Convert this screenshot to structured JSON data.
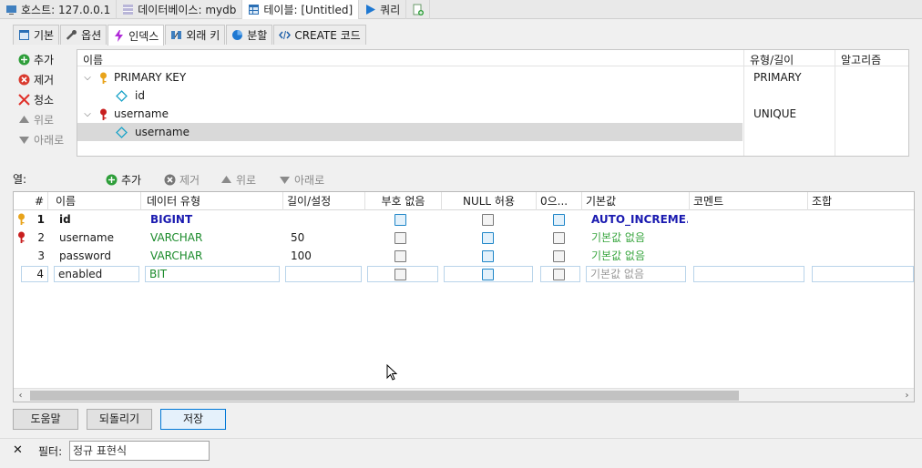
{
  "top_tabs": [
    {
      "label": "호스트: 127.0.0.1",
      "icon": "host-icon"
    },
    {
      "label": "데이터베이스: mydb",
      "icon": "database-icon"
    },
    {
      "label": "테이블: [Untitled]",
      "icon": "table-icon"
    },
    {
      "label": "쿼리",
      "icon": "play-icon"
    },
    {
      "label": "",
      "icon": "new-query-icon"
    }
  ],
  "sub_tabs": [
    {
      "label": "기본",
      "icon": "table-icon"
    },
    {
      "label": "옵션",
      "icon": "wrench-icon"
    },
    {
      "label": "인덱스",
      "icon": "lightning-icon"
    },
    {
      "label": "외래 키",
      "icon": "foreign-key-icon"
    },
    {
      "label": "분할",
      "icon": "partition-icon"
    },
    {
      "label": "CREATE 코드",
      "icon": "code-icon"
    }
  ],
  "index_actions": {
    "add": "추가",
    "remove": "제거",
    "clear": "청소",
    "up": "위로",
    "down": "아래로"
  },
  "index_panel": {
    "headers": {
      "name": "이름",
      "type": "유형/길이",
      "algorithm": "알고리즘"
    },
    "rows": [
      {
        "name": "PRIMARY KEY",
        "type": "PRIMARY"
      },
      {
        "name": "id",
        "type": ""
      },
      {
        "name": "username",
        "type": "UNIQUE"
      },
      {
        "name": "username",
        "type": ""
      }
    ]
  },
  "columns_toolbar": {
    "label": "열:",
    "add": "추가",
    "remove": "제거",
    "up": "위로",
    "down": "아래로"
  },
  "grid": {
    "headers": [
      "#",
      "이름",
      "데이터 유형",
      "길이/설정",
      "부호 없음",
      "NULL 허용",
      "0으...",
      "기본값",
      "코멘트",
      "조합"
    ],
    "rows": [
      {
        "num": "1",
        "name": "id",
        "type": "BIGINT",
        "length": "",
        "unsigned": false,
        "nullable": false,
        "zerofill": false,
        "default": "AUTO_INCREME..."
      },
      {
        "num": "2",
        "name": "username",
        "type": "VARCHAR",
        "length": "50",
        "unsigned": false,
        "nullable": false,
        "zerofill": false,
        "default": "기본값 없음"
      },
      {
        "num": "3",
        "name": "password",
        "type": "VARCHAR",
        "length": "100",
        "unsigned": false,
        "nullable": false,
        "zerofill": false,
        "default": "기본값 없음"
      },
      {
        "num": "4",
        "name": "enabled",
        "type": "BIT",
        "length": "",
        "unsigned": false,
        "nullable": false,
        "zerofill": false,
        "default": "기본값 없음"
      }
    ]
  },
  "buttons": {
    "help": "도움말",
    "revert": "되돌리기",
    "save": "저장"
  },
  "filter": {
    "close": "✕",
    "label": "필터:",
    "placeholder": "정규 표현식"
  }
}
